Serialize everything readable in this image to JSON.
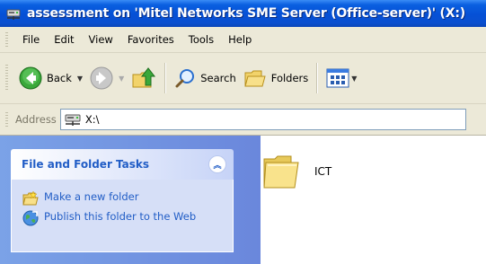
{
  "window": {
    "title": "assessment on 'Mitel Networks SME Server (Office-server)' (X:)"
  },
  "menu": [
    "File",
    "Edit",
    "View",
    "Favorites",
    "Tools",
    "Help"
  ],
  "toolbar": {
    "back": "Back",
    "search": "Search",
    "folders": "Folders"
  },
  "address": {
    "label": "Address",
    "value": "X:\\"
  },
  "taskpane": {
    "title": "File and Folder Tasks",
    "tasks": [
      "Make a new folder",
      "Publish this folder to the Web"
    ]
  },
  "files": [
    {
      "name": "ICT",
      "type": "folder"
    }
  ],
  "colors": {
    "title_bar": "#0550d6",
    "task_link": "#215dc6",
    "taskpane_bg": "#7ba2e7"
  }
}
